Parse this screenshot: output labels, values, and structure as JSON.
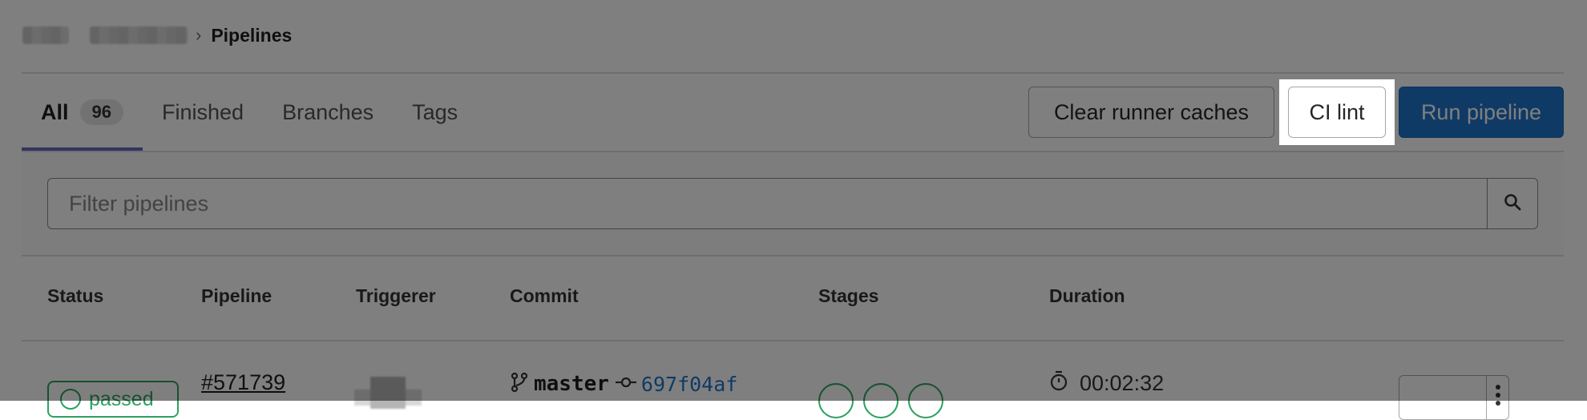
{
  "breadcrumb": {
    "separator": "›",
    "current": "Pipelines"
  },
  "tabs": [
    {
      "label": "All",
      "count": "96",
      "active": true
    },
    {
      "label": "Finished",
      "active": false
    },
    {
      "label": "Branches",
      "active": false
    },
    {
      "label": "Tags",
      "active": false
    }
  ],
  "buttons": {
    "clear_runner_caches": "Clear runner caches",
    "ci_lint": "CI lint",
    "run_pipeline": "Run pipeline"
  },
  "filter": {
    "placeholder": "Filter pipelines"
  },
  "table": {
    "headers": {
      "status": "Status",
      "pipeline": "Pipeline",
      "triggerer": "Triggerer",
      "commit": "Commit",
      "stages": "Stages",
      "duration": "Duration"
    },
    "rows": [
      {
        "status": "passed",
        "pipeline_id": "#571739",
        "branch": "master",
        "commit_sha": "697f04af",
        "duration": "00:02:32",
        "stages": [
          "passed",
          "passed",
          "passed"
        ]
      }
    ]
  },
  "colors": {
    "accent": "#1f75cb",
    "success": "#2da160",
    "active_tab": "#6666c4"
  },
  "icons": {
    "search": "search-icon",
    "branch": "branch-icon",
    "commit": "commit-icon",
    "timer": "timer-icon",
    "play": "play-icon",
    "more": "kebab-icon"
  }
}
